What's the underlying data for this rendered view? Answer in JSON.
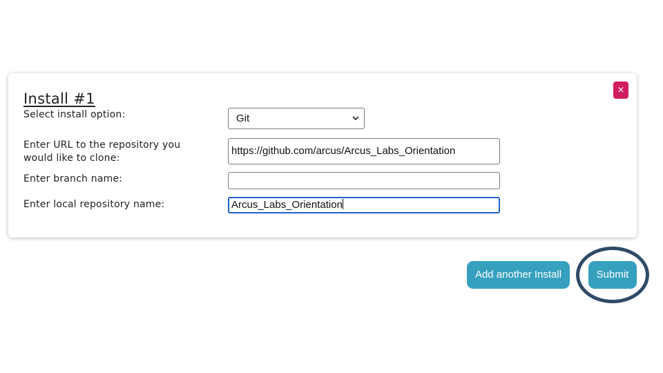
{
  "install": {
    "title": "Install #1",
    "close_glyph": "×",
    "close_icon": "close-icon",
    "install_option_label": "Select install option:",
    "install_option_value": "Git",
    "install_option_chevron": "⌄",
    "repo_url_label": "Enter URL to the repository you would like to clone:",
    "repo_url_value": "https://github.com/arcus/Arcus_Labs_Orientation",
    "branch_label": "Enter branch name:",
    "branch_value": "",
    "local_repo_label": "Enter local repository name:",
    "local_repo_value": "Arcus_Labs_Orientation"
  },
  "actions": {
    "add_another_label": "Add another Install",
    "submit_label": "Submit"
  },
  "colors": {
    "button": "#36a0be",
    "close": "#d11d5f",
    "highlight": "#2e4a66",
    "focus": "#1d62c9"
  }
}
